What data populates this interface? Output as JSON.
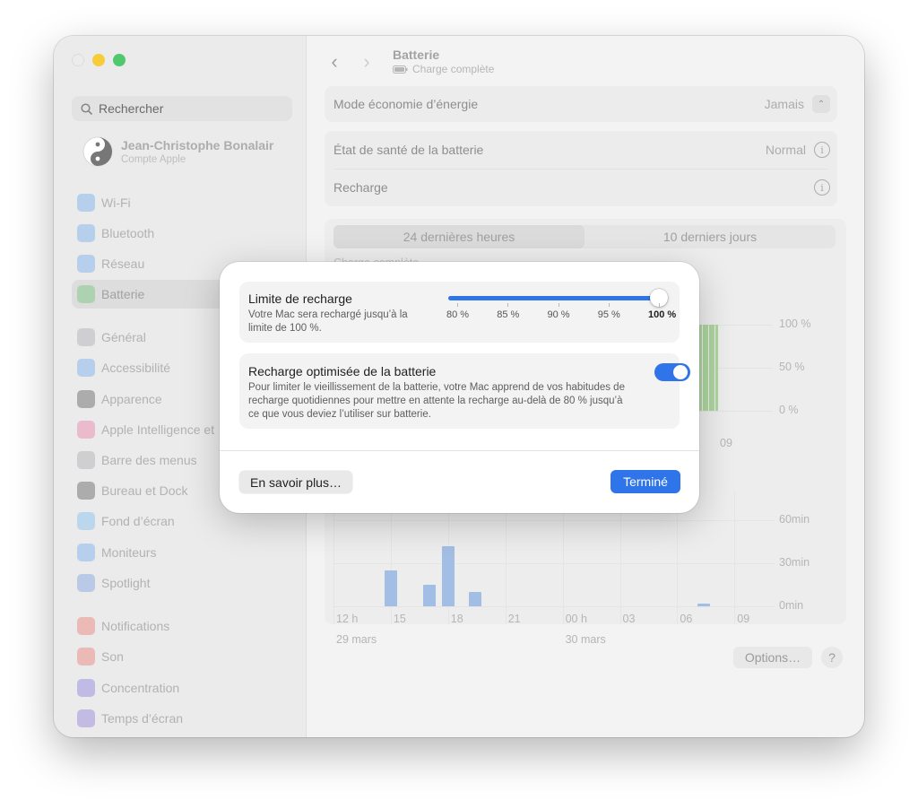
{
  "window": {
    "title": "Batterie",
    "subtitle": "Charge complète",
    "subtitle_icon": "battery-plug-icon"
  },
  "sidebar": {
    "search_placeholder": "Rechercher",
    "account": {
      "name": "Jean-Christophe Bonalair",
      "subtitle": "Compte Apple"
    },
    "items": [
      {
        "label": "Wi-Fi",
        "icon": "wifi-icon",
        "color": "#3b8ef0"
      },
      {
        "label": "Bluetooth",
        "icon": "bluetooth-icon",
        "color": "#3b8ef0"
      },
      {
        "label": "Réseau",
        "icon": "globe-icon",
        "color": "#3b8ef0"
      },
      {
        "label": "Batterie",
        "icon": "battery-icon",
        "color": "#3fb44d",
        "active": true
      },
      {
        "label": "Général",
        "icon": "gear-icon",
        "color": "#8e8e93"
      },
      {
        "label": "Accessibilité",
        "icon": "accessibility-icon",
        "color": "#3b8ef0"
      },
      {
        "label": "Apparence",
        "icon": "appearance-icon",
        "color": "#1c1c1e"
      },
      {
        "label": "Apple Intelligence et",
        "icon": "apple-intelligence-icon",
        "color": "#e4508a"
      },
      {
        "label": "Barre des menus",
        "icon": "menubar-icon",
        "color": "#8e8e93"
      },
      {
        "label": "Bureau et Dock",
        "icon": "dock-icon",
        "color": "#1c1c1e"
      },
      {
        "label": "Fond d’écran",
        "icon": "wallpaper-icon",
        "color": "#4aa7f0"
      },
      {
        "label": "Moniteurs",
        "icon": "display-icon",
        "color": "#3b8ef0"
      },
      {
        "label": "Spotlight",
        "icon": "spotlight-icon",
        "color": "#4a7fd8"
      },
      {
        "label": "Notifications",
        "icon": "bell-icon",
        "color": "#e8473f"
      },
      {
        "label": "Son",
        "icon": "speaker-icon",
        "color": "#e8473f"
      },
      {
        "label": "Concentration",
        "icon": "moon-icon",
        "color": "#5a4fd0"
      },
      {
        "label": "Temps d’écran",
        "icon": "hourglass-icon",
        "color": "#6c4fd0"
      }
    ]
  },
  "main": {
    "rows": [
      {
        "label": "Mode économie d’énergie",
        "value": "Jamais",
        "control": "stepper-icon"
      },
      {
        "label": "État de santé de la batterie",
        "value": "Normal",
        "control": "info-icon"
      },
      {
        "label": "Recharge",
        "value": "",
        "control": "info-icon"
      }
    ],
    "segments": [
      {
        "label": "24 dernières heures",
        "selected": true
      },
      {
        "label": "10 derniers jours",
        "selected": false
      }
    ],
    "chart_label_fragment": "Charge complète",
    "options_label": "Options…",
    "help_label": "?"
  },
  "chart_data": [
    {
      "type": "bar",
      "series": [
        {
          "values": [
            100,
            100,
            100,
            100,
            100,
            100,
            100,
            100,
            100,
            100
          ]
        }
      ],
      "y_ticks": [
        "100 %",
        "50 %",
        "0 %"
      ],
      "x_ticks": [
        "09"
      ],
      "ylim": [
        0,
        100
      ],
      "color": "#9ccc8c"
    },
    {
      "type": "bar",
      "x_ticks": [
        "12 h",
        "15",
        "18",
        "21",
        "00 h",
        "03",
        "06",
        "09"
      ],
      "x_sub_labels": [
        "29 mars",
        "30 mars"
      ],
      "y_ticks": [
        "60min",
        "30min",
        "0min"
      ],
      "ylim": [
        0,
        60
      ],
      "series": [
        {
          "values": [
            {
              "t": 15.0,
              "min": 25
            },
            {
              "t": 17.0,
              "min": 15
            },
            {
              "t": 18.0,
              "min": 42
            },
            {
              "t": 19.4,
              "min": 10
            },
            {
              "t": 31.4,
              "min": 2
            }
          ]
        }
      ],
      "color": "#8fb0de"
    }
  ],
  "modal": {
    "charge_limit": {
      "title": "Limite de recharge",
      "description": "Votre Mac sera rechargé jusqu’à la limite de 100 %.",
      "ticks": [
        "80 %",
        "85 %",
        "90 %",
        "95 %",
        "100 %"
      ],
      "value_percent": 100,
      "min_percent": 80,
      "max_percent": 100
    },
    "optimized": {
      "title": "Recharge optimisée de la batterie",
      "description": "Pour limiter le vieillissement de la batterie, votre Mac apprend de vos habitudes de recharge quotidiennes pour mettre en attente la recharge au-delà de 80 % jusqu’à ce que vous deviez l’utiliser sur batterie.",
      "enabled": true
    },
    "learn_more_label": "En savoir plus…",
    "done_label": "Terminé"
  }
}
